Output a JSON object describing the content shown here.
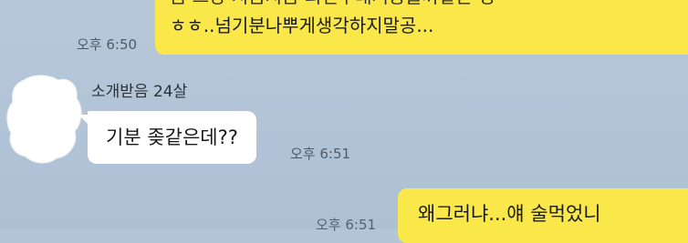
{
  "messages": {
    "out_1": {
      "line_1_cut": "음 그냥 지금지금 외전부대거등을까같은 정",
      "line_2": "ㅎㅎ..넘기분나뿌게생각하지말공...",
      "time": "오후 6:50"
    },
    "in_1": {
      "sender": "소개받음 24살",
      "text": "기분 좆같은데??",
      "time": "오후 6:51"
    },
    "out_2": {
      "text": "왜그러냐...얘 술먹었니",
      "time_partial": "오후 6:51"
    }
  },
  "colors": {
    "background": "#b3c4d6",
    "outgoing_bubble": "#fae84a",
    "incoming_bubble": "#ffffff",
    "timestamp": "#4f5a66"
  }
}
